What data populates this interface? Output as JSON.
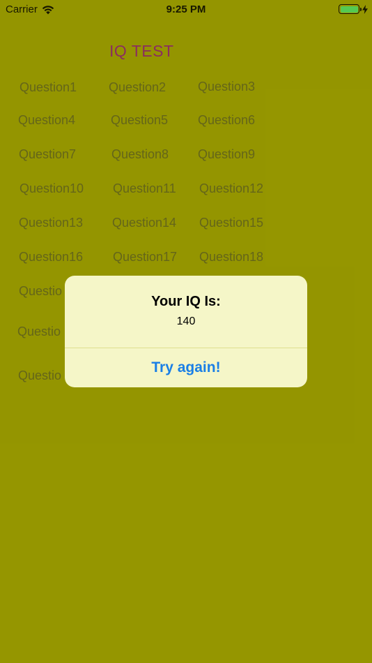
{
  "status_bar": {
    "carrier": "Carrier",
    "time": "9:25 PM",
    "battery_level": 1.0,
    "battery_color": "#4cd964",
    "charging": true
  },
  "app": {
    "title": "IQ TEST",
    "title_color": "#8e1c74",
    "background_color": "#999a00"
  },
  "questions": {
    "q1": "Question1",
    "q2": "Question2",
    "q3": "Question3",
    "q4": "Question4",
    "q5": "Question5",
    "q6": "Question6",
    "q7": "Question7",
    "q8": "Question8",
    "q9": "Question9",
    "q10": "Question10",
    "q11": "Question11",
    "q12": "Question12",
    "q13": "Question13",
    "q14": "Question14",
    "q15": "Question15",
    "q16": "Question16",
    "q17": "Question17",
    "q18": "Question18",
    "q19_partial": "Questio",
    "q22_partial": "Questio",
    "q25_partial": "Questio"
  },
  "alert": {
    "title": "Your IQ Is:",
    "message": "140",
    "button_label": "Try again!",
    "button_color": "#1a7fe6",
    "background_color": "#f5f6c8"
  },
  "icons": {
    "wifi": "wifi-icon",
    "battery": "battery-icon",
    "charging": "bolt-icon"
  }
}
